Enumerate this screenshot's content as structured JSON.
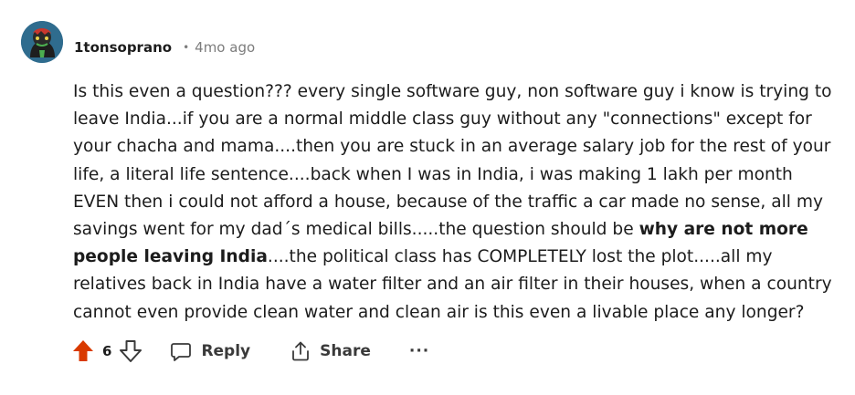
{
  "comment": {
    "author": "1tonsoprano",
    "separator": "•",
    "timestamp": "4mo ago",
    "body": {
      "part1": "Is this even a question??? every single software guy, non software guy i know is trying to leave India...if you are a normal middle class guy without any \"connections\" except for your chacha and mama....then you are stuck in an average salary job for the rest of your life, a literal life sentence....back when I was in India, i was making 1 lakh per month EVEN then i could not afford a house, because of the traffic a car made no sense, all my savings went for my dad´s medical bills.....the question should be ",
      "bold": "why are not more people leaving India",
      "part2": "....the political class has COMPLETELY lost the plot.....all my relatives back in India have a water filter and an air filter in their houses, when a country cannot even provide clean water and clean air is this even a livable place any longer?"
    },
    "vote_count": "6",
    "upvote_color": "#d93a00",
    "actions": {
      "reply_label": "Reply",
      "share_label": "Share",
      "more_label": "···"
    },
    "icons": {
      "avatar": "user-avatar",
      "upvote": "upvote-arrow-icon",
      "downvote": "downvote-arrow-icon",
      "reply": "speech-bubble-icon",
      "share": "share-icon",
      "more": "ellipsis-icon"
    }
  }
}
